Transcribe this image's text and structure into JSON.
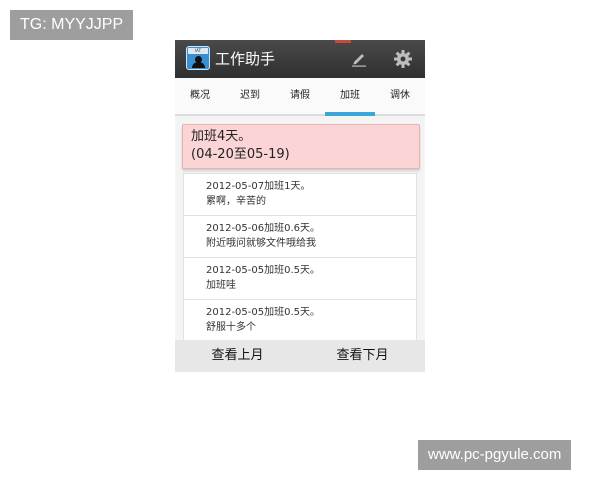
{
  "watermarks": {
    "top_left": "TG: MYYJJPP",
    "bottom_right": "www.pc-pgyule.com"
  },
  "app": {
    "title": "工作助手",
    "icon_tag": "IAT"
  },
  "tabs": [
    {
      "label": "概况",
      "active": false
    },
    {
      "label": "迟到",
      "active": false
    },
    {
      "label": "请假",
      "active": false
    },
    {
      "label": "加班",
      "active": true
    },
    {
      "label": "调休",
      "active": false
    }
  ],
  "summary": {
    "line1": "加班4天。",
    "line2": "(04-20至05-19)"
  },
  "records": [
    {
      "date_line": "2012-05-07加班1天。",
      "note": "累啊，辛苦的"
    },
    {
      "date_line": "2012-05-06加班0.6天。",
      "note": "附近哦问就够文件哦给我"
    },
    {
      "date_line": "2012-05-05加班0.5天。",
      "note": "加班哇"
    },
    {
      "date_line": "2012-05-05加班0.5天。",
      "note": "舒服十多个"
    }
  ],
  "bottom": {
    "prev_month": "查看上月",
    "next_month": "查看下月"
  },
  "colors": {
    "accent": "#3aa7d8",
    "summary_bg": "#fbd4d6",
    "titlebar": "#3a3a3a"
  }
}
